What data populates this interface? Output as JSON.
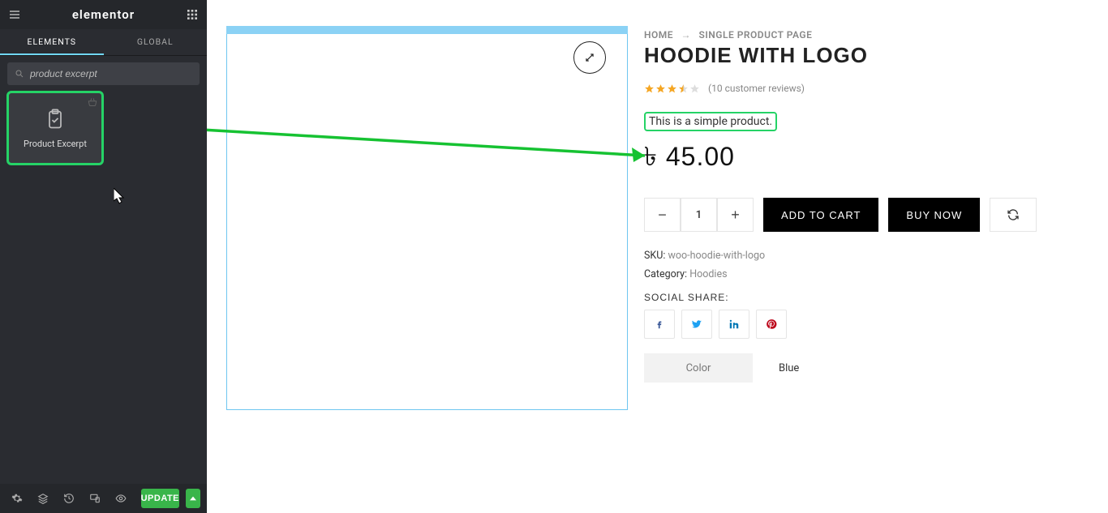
{
  "header": {
    "logo": "elementor"
  },
  "tabs": {
    "elements": "ELEMENTS",
    "global": "GLOBAL"
  },
  "search": {
    "value": "product excerpt"
  },
  "widgets": [
    {
      "label": "Product Excerpt"
    }
  ],
  "footer": {
    "update": "UPDATE"
  },
  "breadcrumb": {
    "home": "HOME",
    "current": "SINGLE PRODUCT PAGE"
  },
  "product": {
    "title": "HOODIE WITH LOGO",
    "reviews_text": "(10 customer reviews)",
    "excerpt": "This is a simple product.",
    "currency": "৳",
    "price": "45.00",
    "qty": "1",
    "add_to_cart": "ADD TO CART",
    "buy_now": "BUY NOW",
    "sku_label": "SKU:",
    "sku_value": "woo-hoodie-with-logo",
    "category_label": "Category:",
    "category_value": "Hoodies",
    "share_label": "SOCIAL SHARE:",
    "attr_label": "Color",
    "attr_value": "Blue"
  }
}
